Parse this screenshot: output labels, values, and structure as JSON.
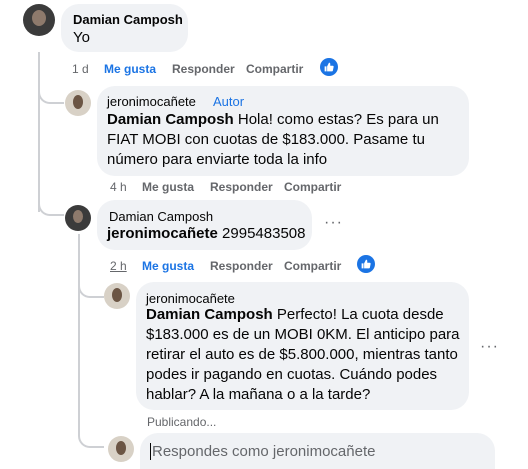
{
  "comments": [
    {
      "author": "Damian Camposh",
      "text": "Yo",
      "time": "1 d",
      "like": "Me gusta",
      "reply": "Responder",
      "share": "Compartir"
    },
    {
      "author": "jeronimocañete",
      "badge": "Autor",
      "mention": "Damian Camposh",
      "text": " Hola! como estas? Es para un FIAT MOBI con cuotas de $183.000. Pasame tu número para enviarte toda la info",
      "time": "4 h",
      "like": "Me gusta",
      "reply": "Responder",
      "share": "Compartir"
    },
    {
      "author": "Damian Camposh",
      "mention": "jeronimocañete",
      "text": " 2995483508",
      "time": "2 h",
      "like": "Me gusta",
      "reply": "Responder",
      "share": "Compartir"
    },
    {
      "author": "jeronimocañete",
      "mention": "Damian Camposh",
      "text": " Perfecto! La cuota desde $183.000 es de un MOBI 0KM. El anticipo para retirar el auto es de $5.800.000, mientras tanto podes ir pagando en cuotas. Cuándo podes hablar? A la mañana o a la tarde?",
      "status": "Publicando..."
    }
  ],
  "composer": {
    "placeholder": "Respondes como jeronimocañete"
  },
  "more_options": "···",
  "colors": {
    "bubble": "#f0f2f5",
    "accent": "#1b74e4",
    "meta": "#65676b",
    "thread_line": "#ced0d4"
  }
}
